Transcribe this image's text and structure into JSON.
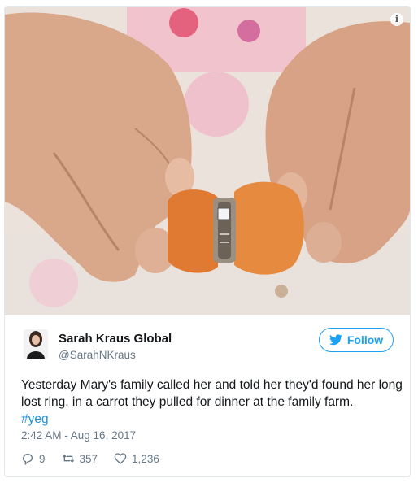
{
  "photo": {
    "alt_subject": "hands holding a carrot with a diamond ring grown around it",
    "info_icon": "info-icon"
  },
  "tweet": {
    "author_name": "Sarah Kraus Global",
    "author_handle": "@SarahNKraus",
    "follow_label": "Follow",
    "text": "Yesterday Mary's family called her and told her they'd found her long lost ring, in a carrot they pulled for dinner at the family farm.",
    "hashtag": "#yeg",
    "timestamp": "2:42 AM - Aug 16, 2017",
    "replies": "9",
    "retweets": "357",
    "likes": "1,236"
  },
  "colors": {
    "twitter_blue": "#1da1f2",
    "hashtag_blue": "#1b95e0",
    "muted": "#657786",
    "carrot": "#e07a32"
  }
}
